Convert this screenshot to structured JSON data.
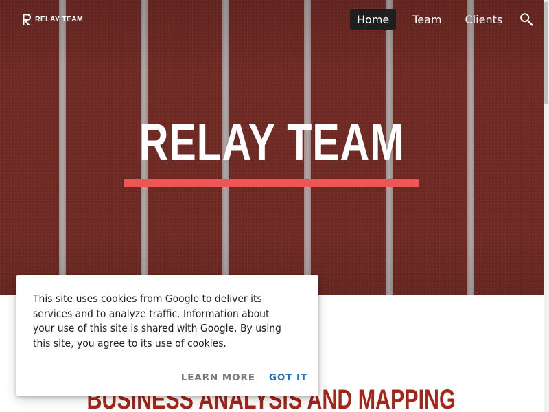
{
  "brand": {
    "logo_text": "RELAY TEAM",
    "logo_icon": "r-logo-icon"
  },
  "nav": {
    "items": [
      {
        "label": "Home",
        "active": true
      },
      {
        "label": "Team",
        "active": false
      },
      {
        "label": "Clients",
        "active": false
      }
    ],
    "search_icon": "search-icon"
  },
  "hero": {
    "title": "RELAY TEAM",
    "accent_color": "#f05555",
    "background_color": "#722a24"
  },
  "section": {
    "heading": "BUSINESS ANALYSIS AND MAPPING",
    "heading_color": "#a52619"
  },
  "cookie_notice": {
    "message": "This site uses cookies from Google to deliver its services and to analyze traffic. Information about your use of this site is shared with Google. By using this site, you agree to its use of cookies.",
    "learn_more_label": "LEARN MORE",
    "got_it_label": "GOT IT",
    "action_color": "#1a73c8"
  }
}
